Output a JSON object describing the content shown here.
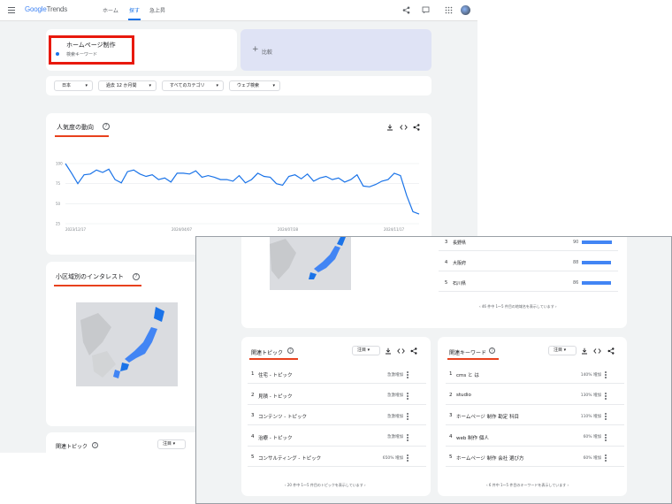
{
  "app": {
    "logo_google": "Google",
    "logo_trends": "Trends",
    "nav": [
      "ホーム",
      "探す",
      "急上昇"
    ]
  },
  "term": {
    "title": "ホームページ制作",
    "subtitle": "検索キーワード",
    "dot_color": "#1a73e8"
  },
  "compare": {
    "plus": "+",
    "label": "比較"
  },
  "filters": [
    {
      "label": "日本"
    },
    {
      "label": "過去 12 か月間"
    },
    {
      "label": "すべてのカテゴリ"
    },
    {
      "label": "ウェブ検索"
    }
  ],
  "interest": {
    "title": "人気度の動向",
    "actions": [
      "download-icon",
      "embed-icon",
      "share-icon"
    ]
  },
  "chart_data": {
    "type": "line",
    "title": "人気度の動向",
    "y_ticks": [
      "100",
      "75",
      "50",
      "25"
    ],
    "ylim": [
      0,
      100
    ],
    "x_ticks": [
      "2023/12/17",
      "2024/04/07",
      "2024/07/28",
      "2024/11/17"
    ],
    "series": [
      {
        "name": "ホームページ制作",
        "color": "#1a73e8",
        "values": [
          100,
          88,
          75,
          86,
          87,
          92,
          89,
          93,
          80,
          76,
          90,
          92,
          87,
          84,
          86,
          80,
          82,
          77,
          88,
          88,
          87,
          91,
          83,
          85,
          83,
          80,
          80,
          78,
          85,
          76,
          80,
          88,
          84,
          83,
          75,
          73,
          84,
          86,
          81,
          87,
          78,
          82,
          84,
          80,
          82,
          77,
          80,
          86,
          72,
          71,
          74,
          78,
          80,
          88,
          85,
          60,
          40,
          37
        ]
      }
    ],
    "grid": true
  },
  "region": {
    "title": "小区域別のインタレスト"
  },
  "topics_bottom_peek": {
    "title": "関連トピック",
    "select": "注目"
  },
  "overlay": {
    "regions": [
      {
        "rank": "3",
        "name": "長野県",
        "value": "90",
        "fill": 0.9
      },
      {
        "rank": "4",
        "name": "大阪府",
        "value": "88",
        "fill": 0.88
      },
      {
        "rank": "5",
        "name": "石川県",
        "value": "86",
        "fill": 0.86
      }
    ],
    "regions_pager": "46 件中 1〜5 件目の地域名を表示しています",
    "topics": {
      "title": "関連トピック",
      "select": "注目",
      "rows": [
        {
          "rank": "1",
          "label": "住宅 - トピック",
          "value": "急激増加"
        },
        {
          "rank": "2",
          "label": "見積 - トピック",
          "value": "急激増加"
        },
        {
          "rank": "3",
          "label": "コンテンツ - トピック",
          "value": "急激増加"
        },
        {
          "rank": "4",
          "label": "治療 - トピック",
          "value": "急激増加"
        },
        {
          "rank": "5",
          "label": "コンサルティング - トピック",
          "value": "650% 増加"
        }
      ],
      "pager": "20 件中 1〜5 件目のトピックを表示しています"
    },
    "queries": {
      "title": "関連キーワード",
      "select": "注目",
      "rows": [
        {
          "rank": "1",
          "label": "cms と は",
          "value": "140% 増加"
        },
        {
          "rank": "2",
          "label": "studio",
          "value": "130% 増加"
        },
        {
          "rank": "3",
          "label": "ホームページ 制作 勘定 科目",
          "value": "110% 増加"
        },
        {
          "rank": "4",
          "label": "web 制作 個人",
          "value": "60% 増加"
        },
        {
          "rank": "5",
          "label": "ホームページ 制作 会社 選び方",
          "value": "60% 増加"
        }
      ],
      "pager": "6 件中 1〜5 件目のキーワードを表示しています"
    }
  },
  "colors": {
    "accent": "#1a73e8",
    "highlight": "#e8190d",
    "underline": "#e8411d",
    "page_bg": "#f1f3f4"
  }
}
